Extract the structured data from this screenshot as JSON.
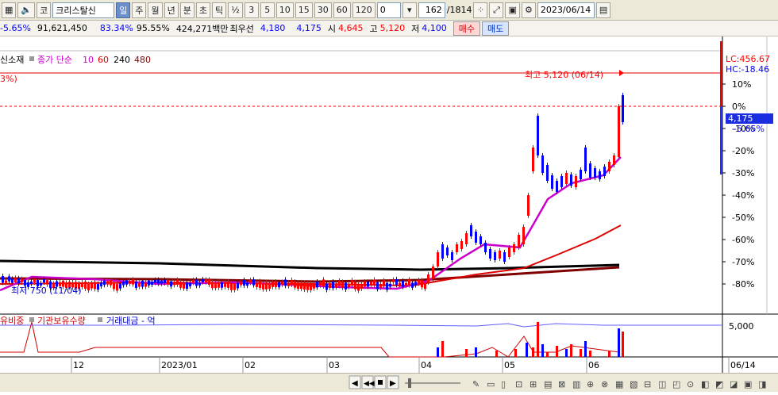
{
  "toolbar": {
    "market_label": "코",
    "stock_name": "크리스탈신",
    "periods": [
      "일",
      "주",
      "월",
      "년",
      "분",
      "초",
      "틱"
    ],
    "active_period": "일",
    "half": "½",
    "intervals": [
      "3",
      "5",
      "10",
      "15",
      "30",
      "60",
      "120"
    ],
    "interval_value": "0",
    "count_value": "162",
    "count_total": "/1814",
    "date_value": "2023/06/14"
  },
  "info": {
    "change_pct": "-5.65%",
    "volume": "91,621,450",
    "ratio1": "83.34%",
    "ratio2": "95.55%",
    "amount": "424,271백만",
    "best_ask_label": "최우선",
    "best_ask": "4,180",
    "best_bid": "4,175",
    "open_label": "시",
    "open": "4,645",
    "high_label": "고",
    "high": "5,120",
    "low_label": "저",
    "low": "4,100",
    "buy_label": "매수",
    "sell_label": "매도"
  },
  "chart_title": {
    "name_fragment": "신소재",
    "ma_label": "종가 단순",
    "ma_periods": [
      "10",
      "60",
      "240",
      "480"
    ],
    "left_fragment": "3%)"
  },
  "annotations": {
    "high": "최고 5,120 (06/14)",
    "low": "최저 750 (11/04)",
    "lc": "LC:456.67",
    "hc": "HC:-18.46",
    "price_tag": "4,175",
    "price_change": "-5.65%"
  },
  "y_axis": [
    "10%",
    "0%",
    "-10%",
    "-20%",
    "-30%",
    "-40%",
    "-50%",
    "-60%",
    "-70%",
    "-80%"
  ],
  "x_axis": [
    "12",
    "2023/01",
    "02",
    "03",
    "04",
    "05",
    "06",
    "06/14"
  ],
  "volume_panel": {
    "labels": [
      "유비중",
      "기관보유수량",
      "거래대금 - 억"
    ],
    "tick": "5,000"
  },
  "colors": {
    "up": "#ff0000",
    "down": "#0000ff",
    "ma10": "#cc00cc",
    "ma60": "#dd0000",
    "ma240": "#000000",
    "ma480": "#800000"
  },
  "chart_data": {
    "type": "candlestick",
    "x_range": [
      "2022-11",
      "2023-06-14"
    ],
    "y_axis_unit": "% change relative to reference",
    "approx_closes_pct": {
      "2022-11": -80,
      "2022-12": -79,
      "2023-01": -78,
      "2023-02": -78,
      "2023-03": -79,
      "2023-04-early": -76,
      "2023-04-mid": -62,
      "2023-04-late": -65,
      "2023-05-early": -63,
      "2023-05-mid": -18,
      "2023-05-late": -34,
      "2023-06-early": -26,
      "2023-06-14": -5.65
    },
    "high_price": 5120,
    "high_date": "06/14",
    "low_price": 750,
    "low_date": "11/04"
  }
}
